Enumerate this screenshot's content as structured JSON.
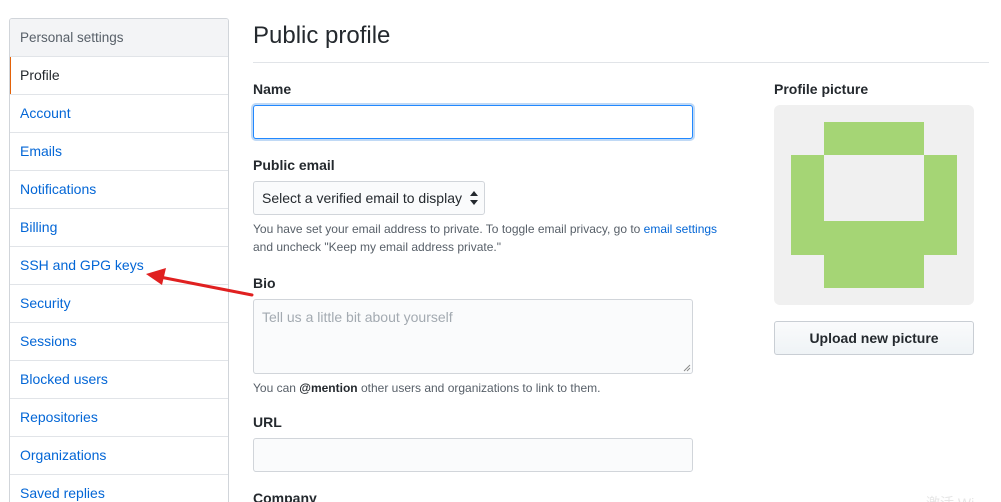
{
  "sidebar": {
    "header": "Personal settings",
    "items": [
      {
        "label": "Profile"
      },
      {
        "label": "Account"
      },
      {
        "label": "Emails"
      },
      {
        "label": "Notifications"
      },
      {
        "label": "Billing"
      },
      {
        "label": "SSH and GPG keys"
      },
      {
        "label": "Security"
      },
      {
        "label": "Sessions"
      },
      {
        "label": "Blocked users"
      },
      {
        "label": "Repositories"
      },
      {
        "label": "Organizations"
      },
      {
        "label": "Saved replies"
      }
    ],
    "selected_index": 0
  },
  "main": {
    "title": "Public profile",
    "name": {
      "label": "Name",
      "value": ""
    },
    "public_email": {
      "label": "Public email",
      "selected": "Select a verified email to display",
      "note_before_link": "You have set your email address to private. To toggle email privacy, go to ",
      "note_link": "email settings",
      "note_after_link": "and uncheck \"Keep my email address private.\""
    },
    "bio": {
      "label": "Bio",
      "placeholder": "Tell us a little bit about yourself",
      "note_prefix": "You can ",
      "note_mention": "@mention",
      "note_suffix": " other users and organizations to link to them."
    },
    "url": {
      "label": "URL",
      "value": ""
    },
    "company": {
      "label": "Company"
    }
  },
  "profile_picture": {
    "label": "Profile picture",
    "upload_label": "Upload new picture",
    "identicon_color": "#a5d575"
  },
  "annotation": {
    "arrow_color": "#e02020"
  },
  "watermark": "激活 Wi"
}
